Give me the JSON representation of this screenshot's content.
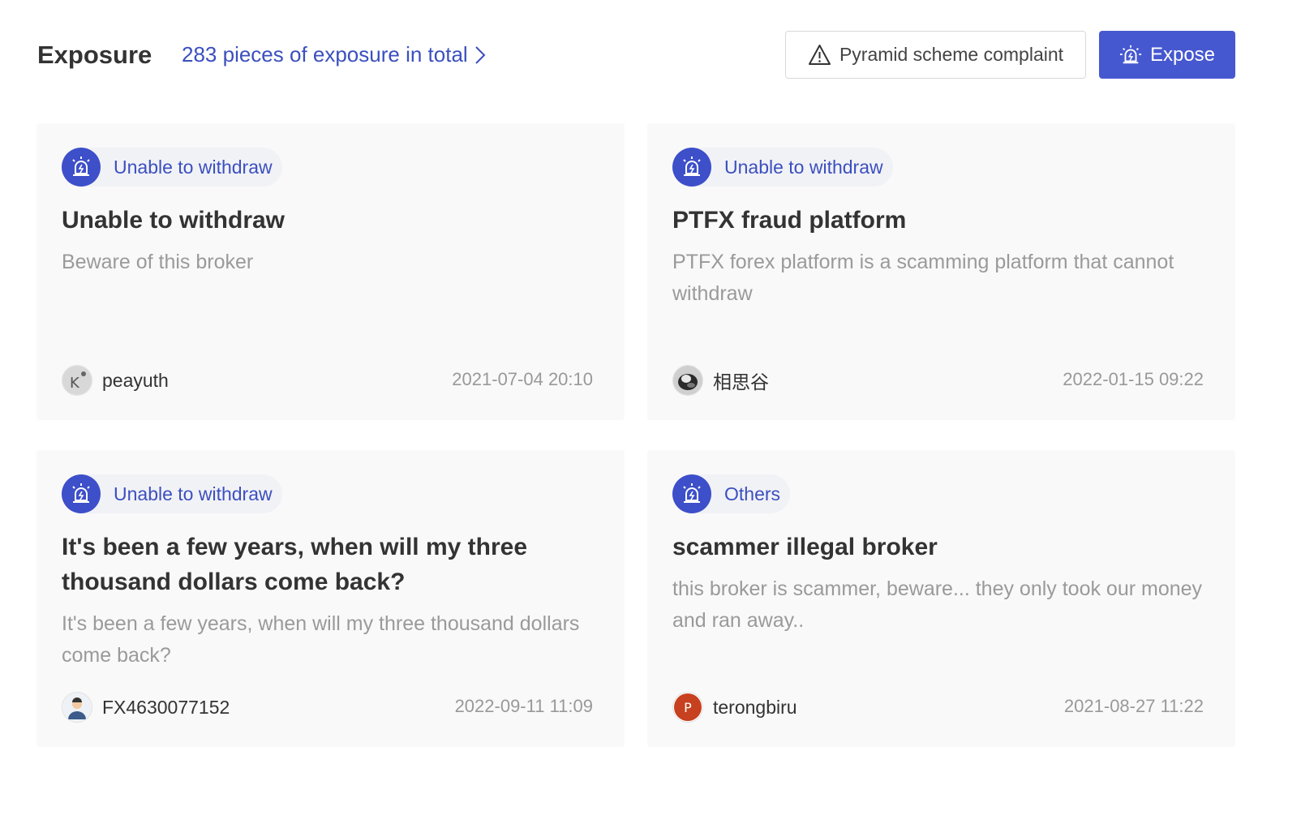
{
  "header": {
    "title": "Exposure",
    "total_link": "283 pieces of exposure in total",
    "complaint_button": "Pyramid scheme complaint",
    "expose_button": "Expose"
  },
  "colors": {
    "accent": "#4658d0",
    "link": "#3b4fbf",
    "card_bg": "#f9f9f9",
    "muted_text": "#9a9a9a"
  },
  "cards": [
    {
      "tag": "Unable to withdraw",
      "title": "Unable to withdraw",
      "description": "Beware of this broker",
      "user": "peayuth",
      "date": "2021-07-04 20:10",
      "avatar_icon": "k-letter-avatar"
    },
    {
      "tag": "Unable to withdraw",
      "title": "PTFX fraud platform",
      "description": "PTFX forex platform is a scamming platform that cannot withdraw",
      "user": "相思谷",
      "date": "2022-01-15 09:22",
      "avatar_icon": "photo-avatar"
    },
    {
      "tag": "Unable to withdraw",
      "title": "It's been a few years, when will my three thousand dollars come back?",
      "description": "It's been a few years, when will my three thousand dollars come back?",
      "user": "FX4630077152",
      "date": "2022-09-11 11:09",
      "avatar_icon": "default-person-avatar"
    },
    {
      "tag": "Others",
      "title": "scammer illegal broker",
      "description": "this broker is scammer, beware... they only took our money and ran away..",
      "user": "terongbiru",
      "date": "2021-08-27 11:22",
      "avatar_icon": "p-letter-avatar",
      "avatar_letter": "P"
    }
  ]
}
